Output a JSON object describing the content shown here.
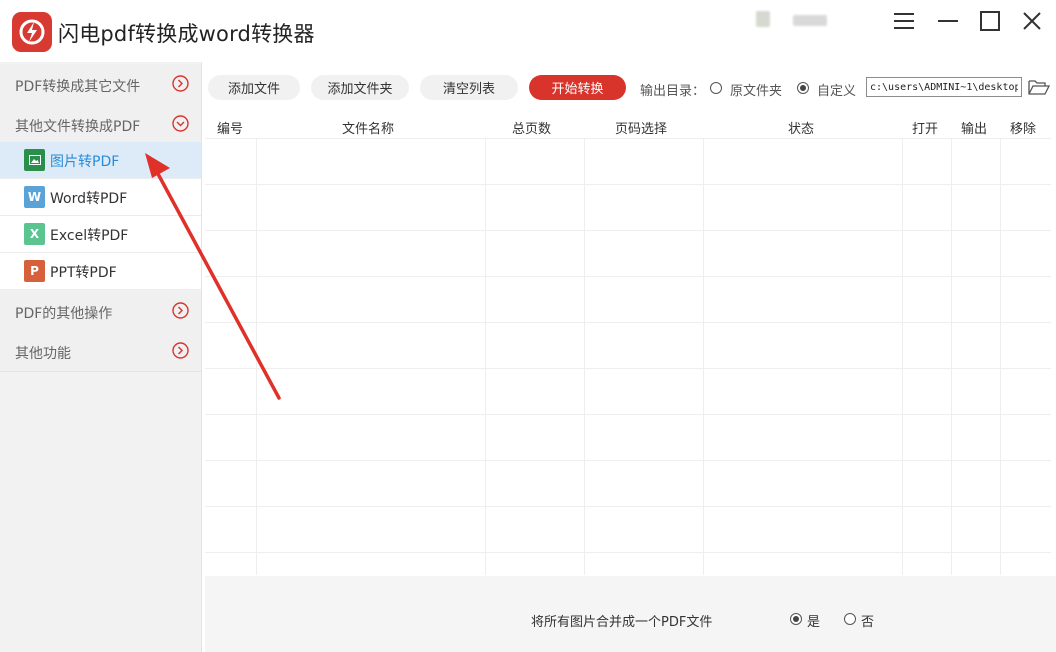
{
  "app": {
    "title": "闪电pdf转换成word转换器",
    "brand_color": "#d8342c"
  },
  "sidebar": {
    "sections": [
      {
        "label": "PDF转换成其它文件",
        "state": "collapsed"
      },
      {
        "label": "其他文件转换成PDF",
        "state": "expanded"
      },
      {
        "label": "PDF的其他操作",
        "state": "collapsed"
      },
      {
        "label": "其他功能",
        "state": "collapsed"
      }
    ],
    "items": [
      {
        "label": "图片转PDF",
        "icon": "image-file-icon",
        "icon_letter": "",
        "color": "#2a8f4a",
        "selected": true
      },
      {
        "label": "Word转PDF",
        "icon": "word-file-icon",
        "icon_letter": "W",
        "color": "#5aa3d8",
        "selected": false
      },
      {
        "label": "Excel转PDF",
        "icon": "excel-file-icon",
        "icon_letter": "X",
        "color": "#5cc490",
        "selected": false
      },
      {
        "label": "PPT转PDF",
        "icon": "ppt-file-icon",
        "icon_letter": "P",
        "color": "#d6603c",
        "selected": false
      }
    ]
  },
  "toolbar": {
    "add_file": "添加文件",
    "add_folder": "添加文件夹",
    "clear_list": "清空列表",
    "start_convert": "开始转换",
    "output_dir_label": "输出目录：",
    "option_source": "原文件夹",
    "option_custom": "自定义",
    "selected_output": "custom",
    "path": "c:\\users\\ADMINI~1\\desktop"
  },
  "table": {
    "columns": [
      "编号",
      "文件名称",
      "总页数",
      "页码选择",
      "状态",
      "打开",
      "输出",
      "移除"
    ],
    "rows": []
  },
  "footer": {
    "merge_label": "将所有图片合并成一个PDF文件",
    "yes": "是",
    "no": "否",
    "merge_selected": "yes"
  }
}
